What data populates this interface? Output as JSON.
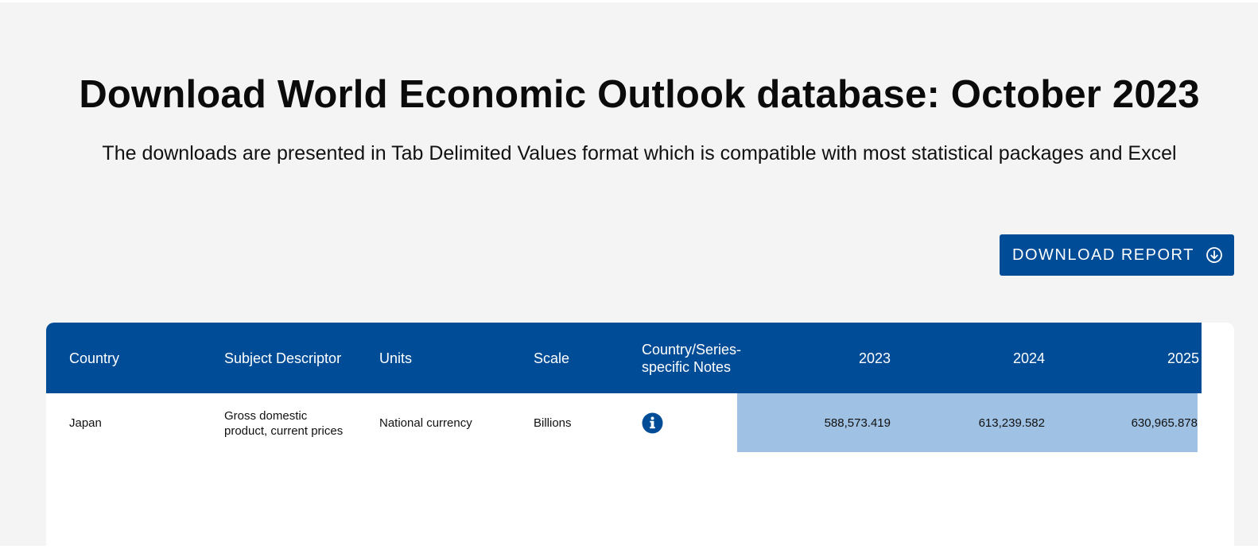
{
  "page": {
    "title": "Download World Economic Outlook database: October 2023",
    "subtitle": "The downloads are presented in Tab Delimited Values format which is compatible with most statistical packages and Excel"
  },
  "toolbar": {
    "download_label": "DOWNLOAD REPORT",
    "download_icon": "circle-arrow-down-icon"
  },
  "table": {
    "headers": {
      "country": "Country",
      "subject": "Subject Descriptor",
      "units": "Units",
      "scale": "Scale",
      "notes": "Country/Series-specific Notes",
      "y2023": "2023",
      "y2024": "2024",
      "y2025": "2025"
    },
    "rows": [
      {
        "country": "Japan",
        "subject": "Gross domestic product, current prices",
        "units": "National currency",
        "scale": "Billions",
        "notes_icon": "info-icon",
        "y2023": "588,573.419",
        "y2024": "613,239.582",
        "y2025": "630,965.878"
      }
    ]
  },
  "colors": {
    "accent": "#004c97",
    "highlight": "#9fc1e3",
    "background": "#f4f4f4"
  }
}
